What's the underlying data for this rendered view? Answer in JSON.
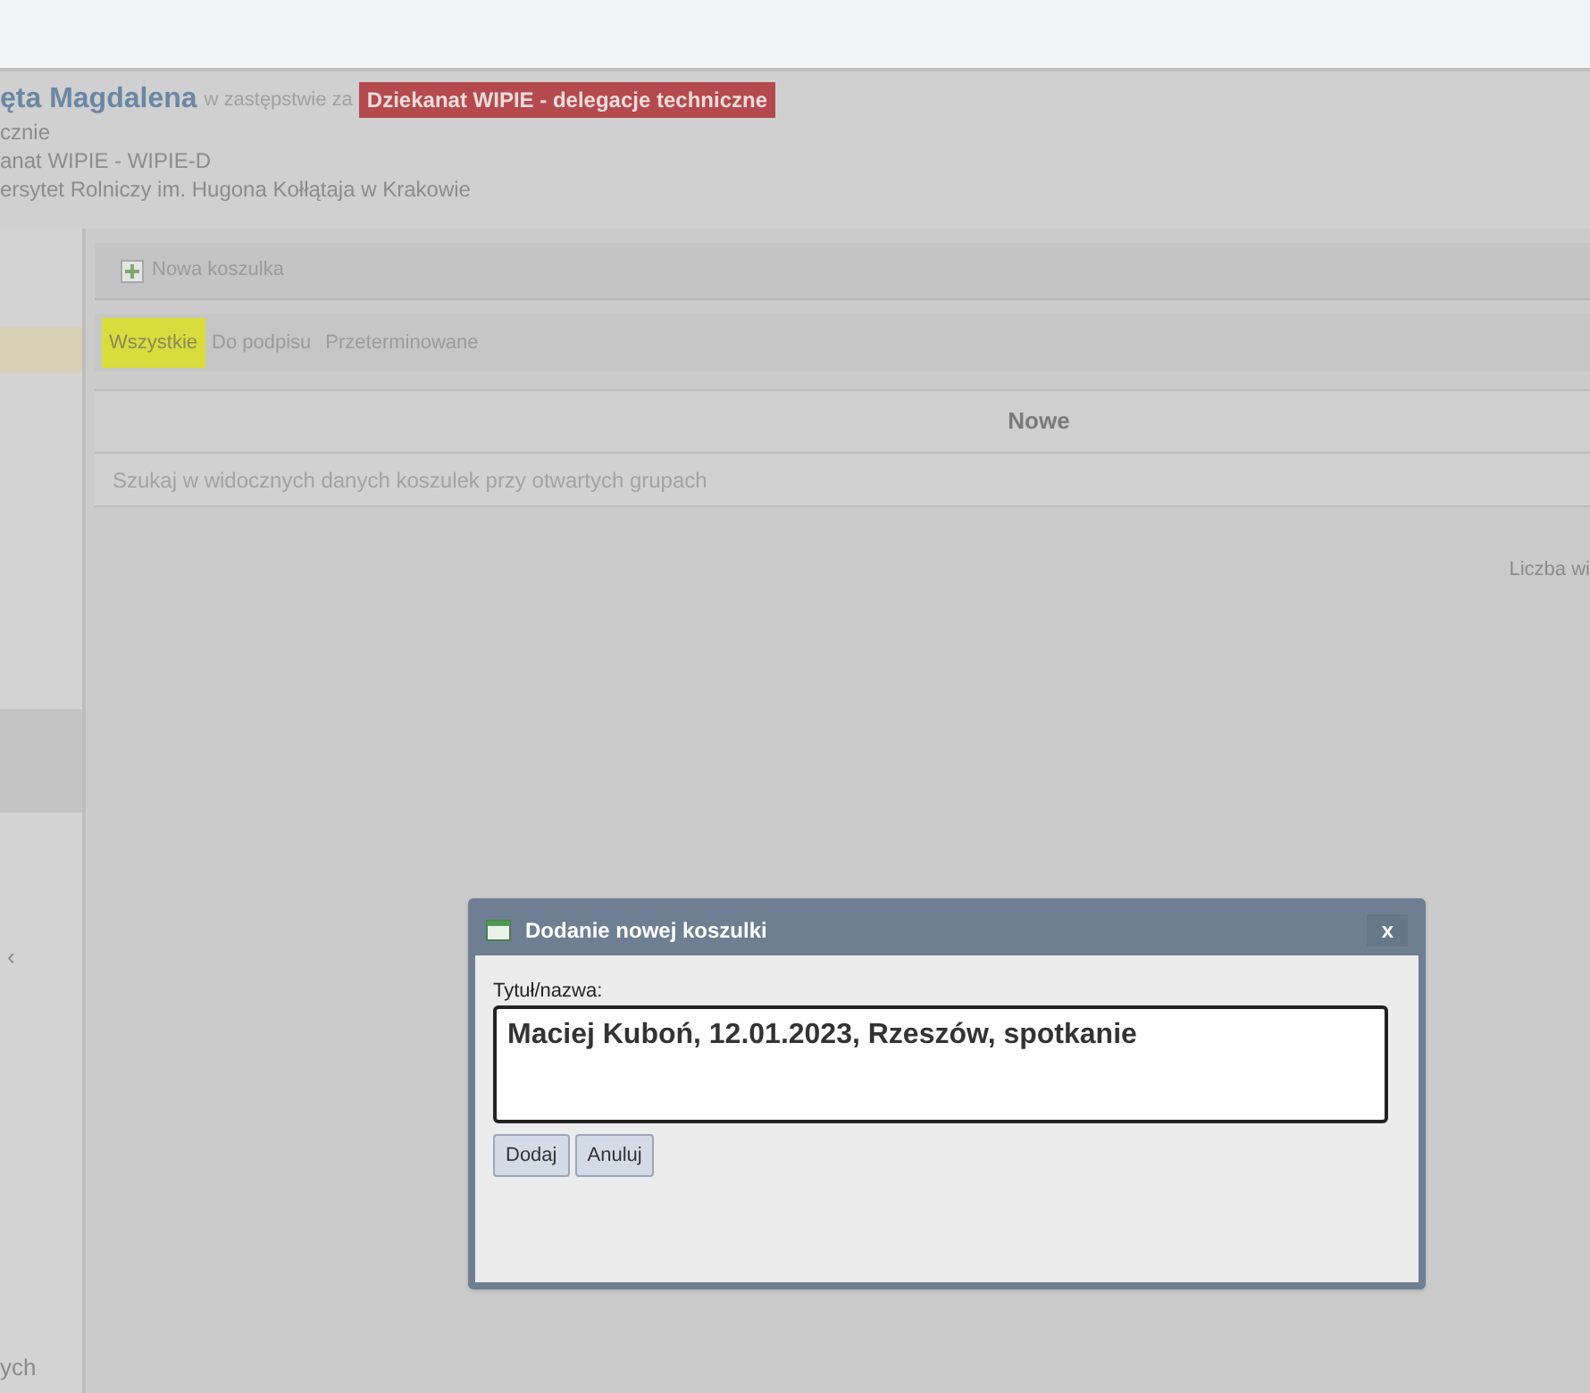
{
  "header": {
    "user_name": "ęta Magdalena",
    "substitution_label": "w zastępstwie za",
    "substitution_badge": "Dziekanat WIPIE - delegacje techniczne",
    "lines": [
      "cznie",
      "anat WIPIE - WIPIE-D",
      "ersytet Rolniczy im. Hugona Kołłątaja w Krakowie"
    ]
  },
  "sidebar": {
    "items": [
      {
        "selected": true
      },
      {
        "selected": false
      }
    ],
    "bottom_text": "ych",
    "chevron": "‹"
  },
  "toolbar": {
    "buttons": [
      "Nowa koszulka"
    ]
  },
  "tabs": [
    {
      "label": "Wszystkie",
      "selected": true
    },
    {
      "label": "Do podpisu",
      "selected": false
    },
    {
      "label": "Przeterminowane",
      "selected": false
    }
  ],
  "column_header": "Nowe",
  "search": {
    "placeholder": "Szukaj w widocznych danych koszulek przy otwartych grupach"
  },
  "count_label": "Liczba wi",
  "dialog": {
    "title": "Dodanie nowej koszulki",
    "close": "x",
    "field_label": "Tytuł/nazwa:",
    "field_value": "Maciej Kuboń, 12.01.2023, Rzeszów, spotkanie",
    "buttons": [
      "Dodaj",
      "Anuluj"
    ]
  }
}
